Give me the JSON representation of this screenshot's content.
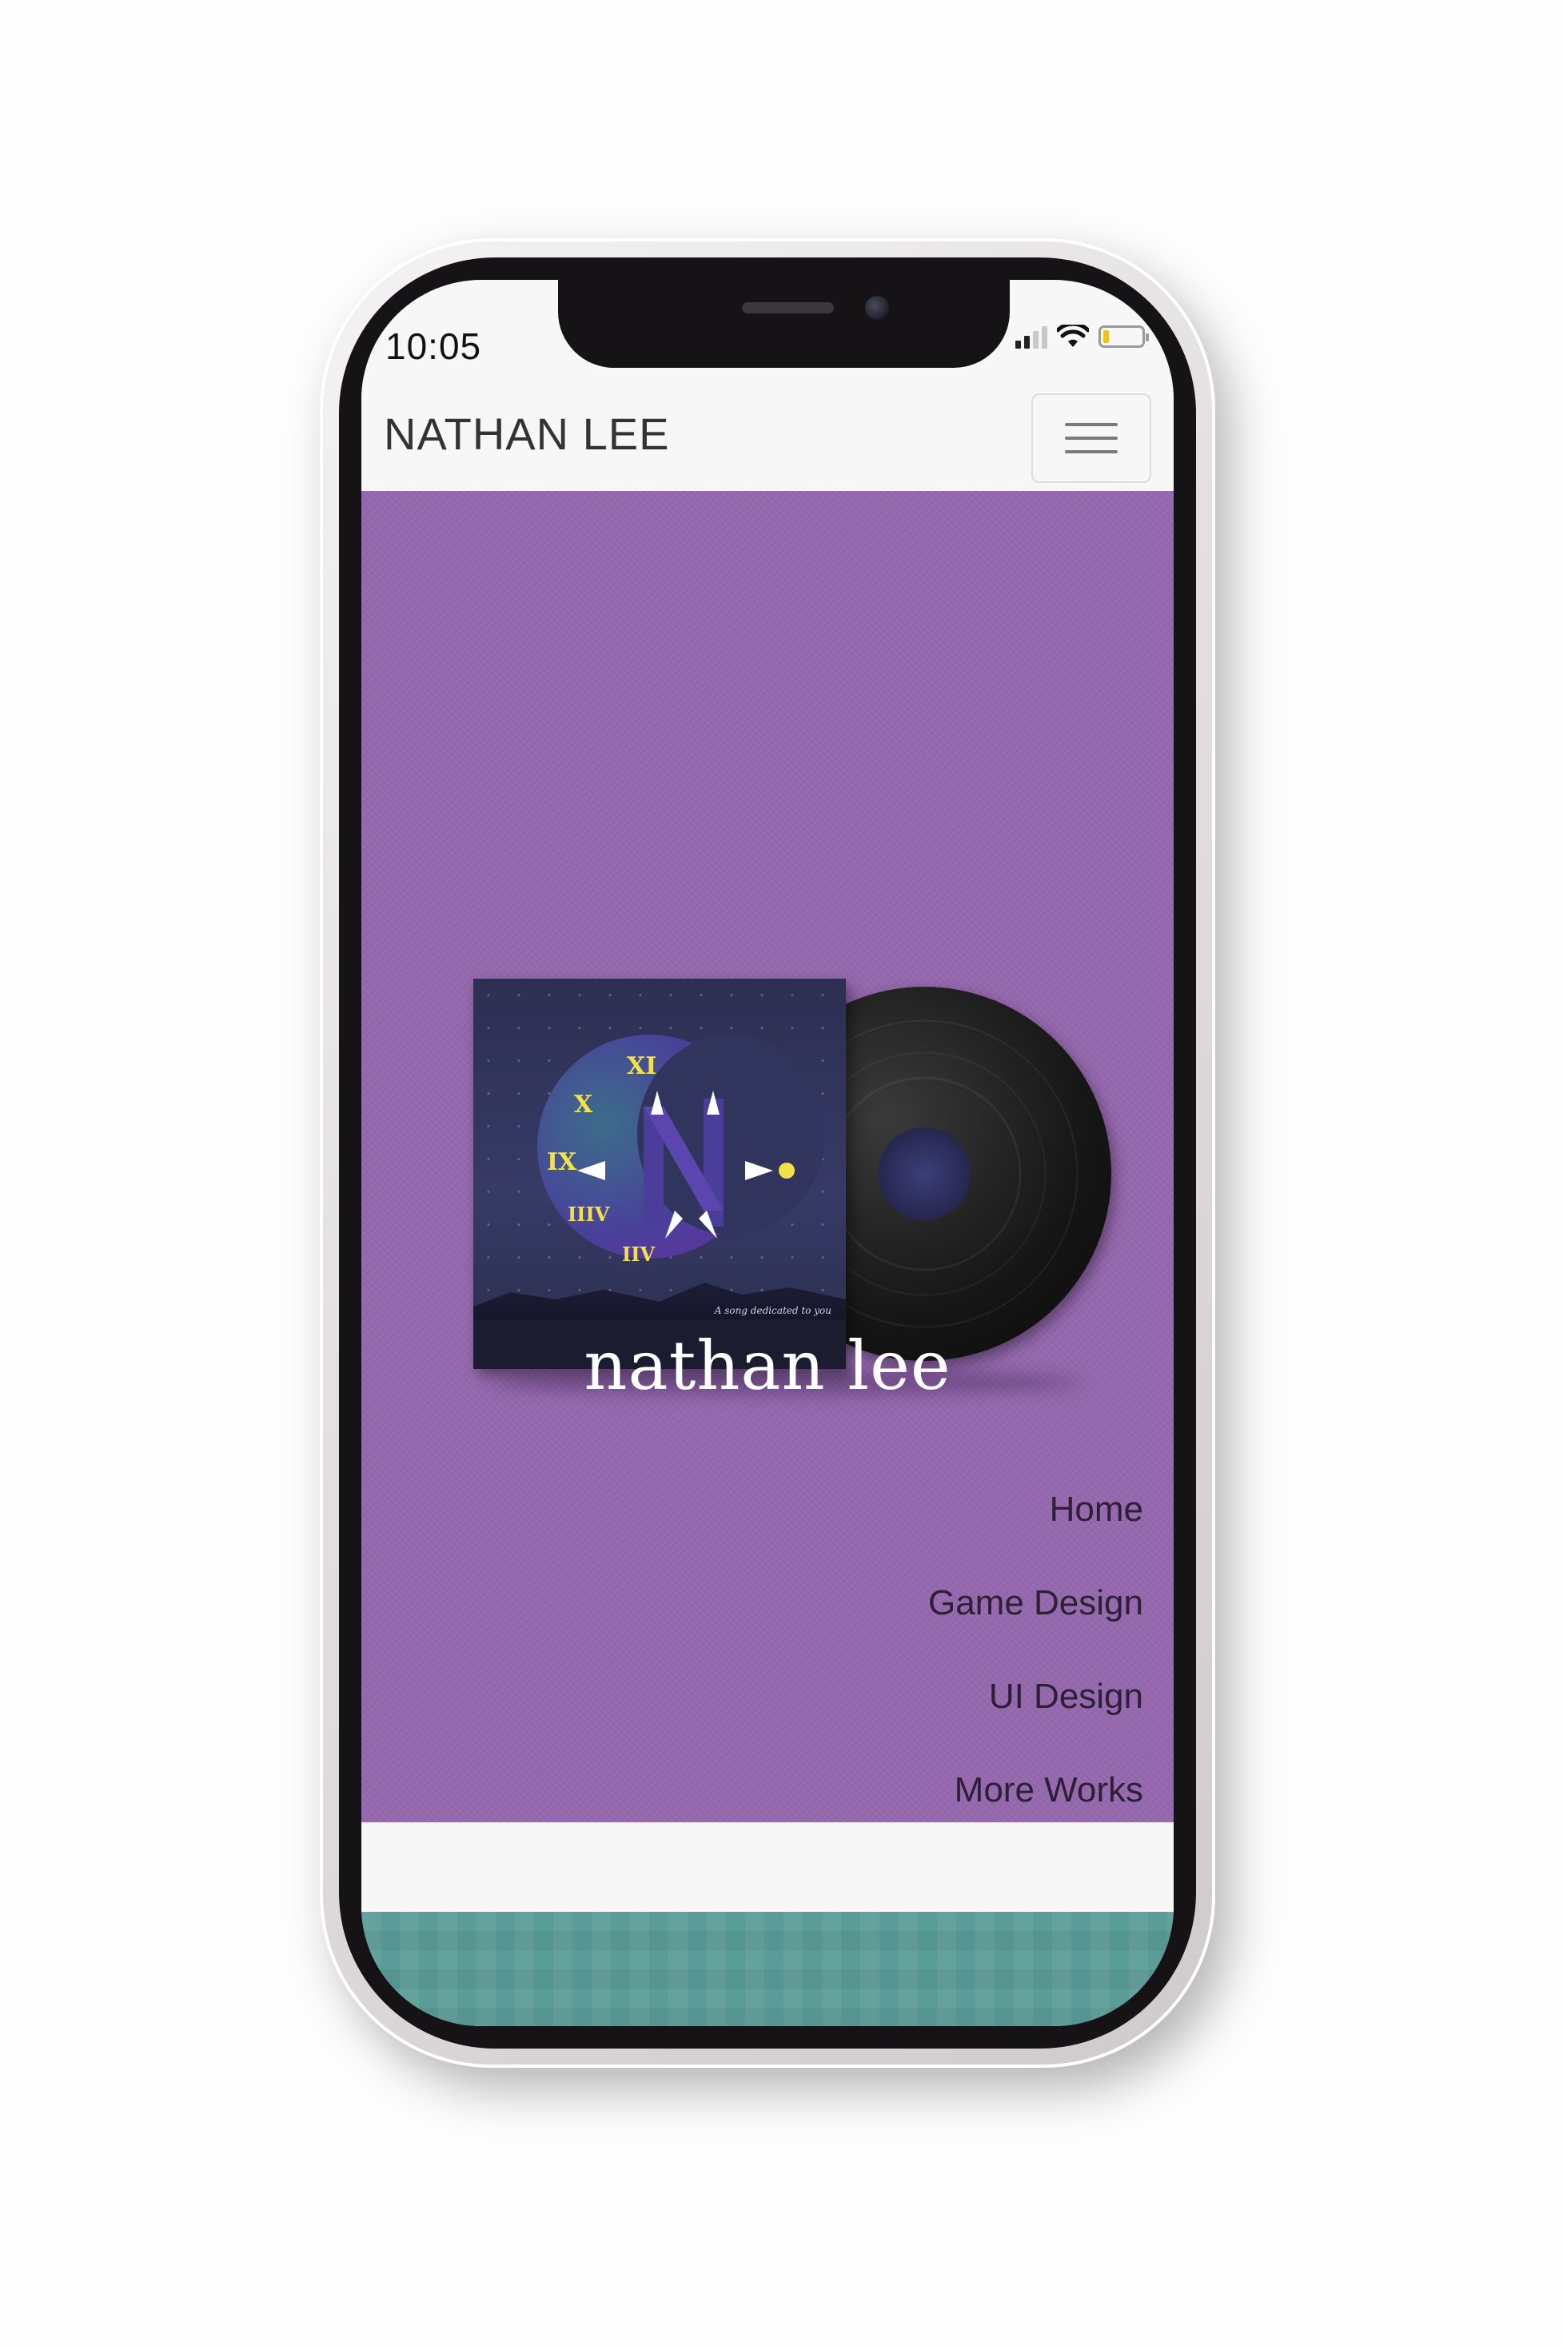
{
  "status_bar": {
    "time": "10:05",
    "icons": [
      "signal-icon",
      "wifi-icon",
      "battery-icon"
    ],
    "battery_level": 0.15
  },
  "navbar": {
    "brand": "NATHAN LEE",
    "menu_icon": "hamburger-menu-icon"
  },
  "hero": {
    "background_color": "#9568ae",
    "title": "nathan lee",
    "album_tagline": "A song dedicated to you",
    "album_numerals": [
      "XI",
      "X",
      "IX",
      "IIIV",
      "IIV"
    ]
  },
  "menu": {
    "items": [
      {
        "label": "Home"
      },
      {
        "label": "Game Design"
      },
      {
        "label": "UI Design"
      },
      {
        "label": "More Works"
      }
    ]
  },
  "colors": {
    "accent_purple": "#9568ae",
    "navbar_bg": "#f7f7f8",
    "teal": "#5a9c98"
  }
}
